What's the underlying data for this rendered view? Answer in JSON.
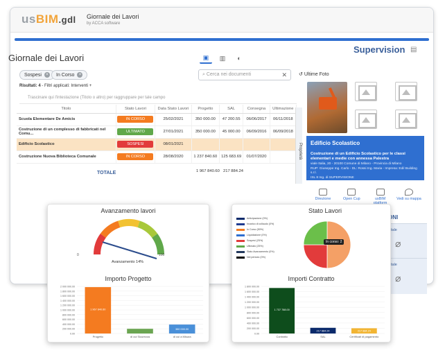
{
  "app": {
    "logo_us": "us",
    "logo_bim": "BIM",
    "logo_gdl": ".gdl",
    "title": "Giornale dei Lavori",
    "subtitle": "by ACCA software"
  },
  "header": {
    "page_title": "Giornale dei Lavori",
    "brand_right": "Supervision"
  },
  "filters": {
    "chips": [
      "Sospesi",
      "In Corso"
    ],
    "search_placeholder": "Cerca nei documenti",
    "results_label": "Risultati: 4",
    "results_note": "- Filtri applicati: Interventi +",
    "group_hint": "Trascinare qui l'intestazione (Titolo o altro) per raggruppare per tale campo"
  },
  "table": {
    "columns": [
      "Titolo",
      "Stato Lavori",
      "Data Stato Lavori",
      "Progetto",
      "SAL",
      "Consegna",
      "Ultimazione"
    ],
    "rows": [
      {
        "title": "Scuola Elementare De Amicis",
        "status": "IN CORSO",
        "status_color": "#f47b20",
        "date": "25/02/2021",
        "project": "350 000.00",
        "sal": "47 200.55",
        "consegna": "06/06/2017",
        "ultimazione": "06/11/2018"
      },
      {
        "title": "Costruzione di un complesso di fabbricati nel Comu...",
        "status": "ULTIMATO",
        "status_color": "#60a84a",
        "date": "27/01/2021",
        "project": "350 000.00",
        "sal": "45 000.00",
        "consegna": "06/09/2016",
        "ultimazione": "06/09/2018"
      },
      {
        "title": "Edificio Scolastico",
        "status": "SOSPESI",
        "status_color": "#e23b3b",
        "date": "08/01/2021",
        "project": "",
        "sal": "",
        "consegna": "",
        "ultimazione": ""
      },
      {
        "title": "Costruzione Nuova Biblioteca Comunale",
        "status": "IN CORSO",
        "status_color": "#f47b20",
        "date": "28/08/2020",
        "project": "1 237 840.60",
        "sal": "125 683.69",
        "consegna": "01/07/2020",
        "ultimazione": ""
      }
    ],
    "total_label": "TOTALE",
    "total_project": "1 967 840.60",
    "total_sal": "217 884.24",
    "side_tab": "Proprietà"
  },
  "right_panel": {
    "photos_label": "Ultime Foto",
    "card_title": "Edificio Scolastico",
    "card_desc": "Costruzione di un Edificio Scolastico per le classi elementari e medie con annessa Palestra",
    "card_addr": "viale Italia, 20 - 20100 Comune di Milano - Provincia di Milano",
    "card_rup": "RUP: Giuseppe Ing. Carlo - DL: Rossi Ing. Maria - Impresa: Edil Building s.r.l.",
    "card_admin": "ISL 8 Ing. di SUPERVISIONE",
    "actions": [
      "Direzione",
      "Open Cup",
      "usBIM platform",
      "Vedi su mappa"
    ],
    "section_heading": "ONI",
    "box_labels": [
      "tale",
      "tale"
    ]
  },
  "gauge_panel": {
    "title": "Avanzamento lavori",
    "value_label": "Avanzamento 14%",
    "min": "0",
    "max": "100",
    "value": 14
  },
  "pie_panel": {
    "title": "Stato Lavori",
    "legend": [
      {
        "label": "Anticipazione (0%)",
        "color": "#0b2a6b"
      },
      {
        "label": "Incarico di collaudo (0%)",
        "color": "#1f3b8f"
      },
      {
        "label": "In Corso (50%)",
        "color": "#f47b20"
      },
      {
        "label": "Liquidazione (0%)",
        "color": "#2f6fd0"
      },
      {
        "label": "Sospesi (25%)",
        "color": "#e23b3b"
      },
      {
        "label": "Ultimato (25%)",
        "color": "#60a84a"
      },
      {
        "label": "Stato Avanzamento (0%)",
        "color": "#243a5e"
      },
      {
        "label": "Nel periodo (0%)",
        "color": "#000000"
      }
    ],
    "tooltip": "In corso: 2"
  },
  "chart_data": [
    {
      "type": "gauge",
      "title": "Avanzamento lavori",
      "value": 14,
      "range": [
        0,
        100
      ],
      "bands": [
        "#e23b3b",
        "#f47b20",
        "#f2c232",
        "#a8c83a",
        "#60a84a"
      ]
    },
    {
      "type": "pie",
      "title": "Stato Lavori",
      "labels": [
        "In Corso",
        "Sospesi",
        "Ultimato"
      ],
      "values": [
        50,
        25,
        25
      ],
      "colors": [
        "#f4a066",
        "#e23b3b",
        "#6bbf4a"
      ]
    },
    {
      "type": "bar",
      "title": "Importo Progetto",
      "categories": [
        "Progetto",
        "di cui Sicurezza",
        "di cui a Misura"
      ],
      "values": [
        1967840.6,
        200000,
        380000
      ],
      "data_labels": [
        "1 967 840.60",
        "",
        "380 000.00"
      ],
      "colors": [
        "#f47b20",
        "#6ba552",
        "#4a90d9"
      ],
      "yticks": [
        "0.00",
        "200 000.00",
        "400 000.00",
        "600 000.00",
        "800 000.00",
        "1 000 000.00",
        "1 200 000.00",
        "1 400 000.00",
        "1 600 000.00",
        "1 800 000.00",
        "2 000 000.00"
      ],
      "ylim": [
        0,
        2000000
      ]
    },
    {
      "type": "bar",
      "title": "Importi Contratto",
      "categories": [
        "Contratto",
        "SAL",
        "Certificati di pagamento"
      ],
      "values": [
        1737788,
        217884.24,
        200000
      ],
      "data_labels": [
        "1 737 788.00",
        "217 884.24",
        "217 884.24"
      ],
      "colors": [
        "#0e4d1c",
        "#0b2a6b",
        "#f2b533"
      ],
      "yticks": [
        "0.00",
        "200 000.00",
        "400 000.00",
        "600 000.00",
        "800 000.00",
        "1 000 000.00",
        "1 200 000.00",
        "1 400 000.00",
        "1 600 000.00",
        "1 800 000.00"
      ],
      "ylim": [
        0,
        1800000
      ]
    }
  ],
  "bar1_panel": {
    "title": "Importo Progetto"
  },
  "bar2_panel": {
    "title": "Importi Contratto"
  }
}
